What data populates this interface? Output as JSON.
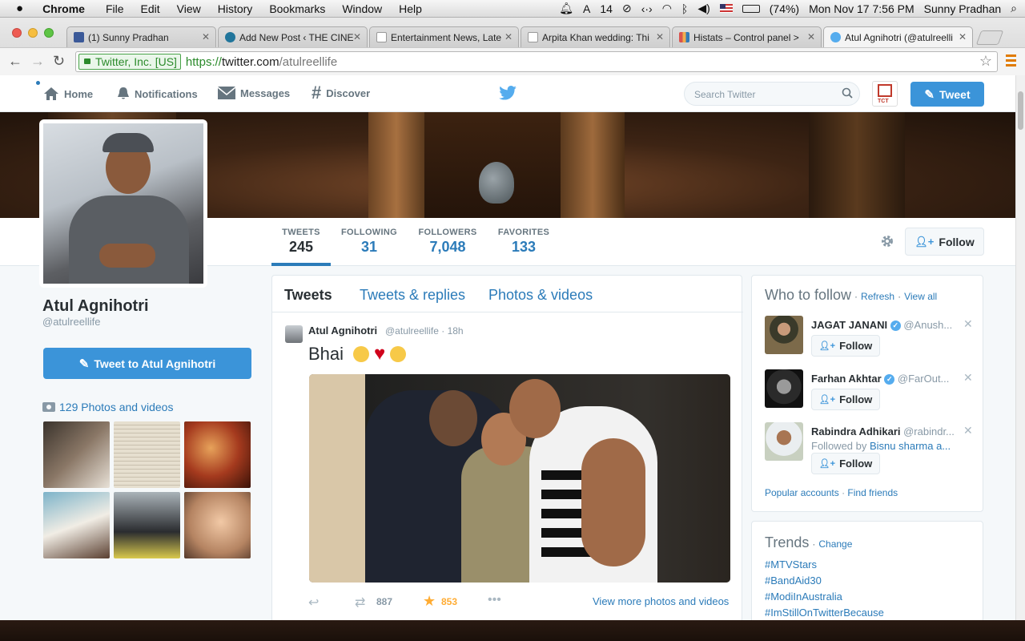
{
  "menubar": {
    "apple": "",
    "app": "Chrome",
    "items": [
      "File",
      "Edit",
      "View",
      "History",
      "Bookmarks",
      "Window",
      "Help"
    ],
    "status_count": "14",
    "battery": "(74%)",
    "datetime": "Mon Nov 17  7:56 PM",
    "user": "Sunny Pradhan"
  },
  "browser": {
    "tabs": [
      {
        "title": "(1) Sunny Pradhan",
        "favicon_color": "#3b5998"
      },
      {
        "title": "Add New Post ‹ THE CINE",
        "favicon_color": "#21759b"
      },
      {
        "title": "Entertainment News, Late",
        "favicon_color": "#999999"
      },
      {
        "title": "Arpita Khan wedding: Thi",
        "favicon_color": "#999999"
      },
      {
        "title": "Histats – Control panel >",
        "favicon_color": "#d9534f"
      },
      {
        "title": "Atul Agnihotri (@atulreelli",
        "favicon_color": "#55acee"
      }
    ],
    "ev_label": "Twitter, Inc. [US]",
    "url_scheme": "https://",
    "url_host": "twitter.com",
    "url_path": "/atulreellife"
  },
  "twitter": {
    "nav": {
      "home": "Home",
      "notifications": "Notifications",
      "messages": "Messages",
      "discover": "Discover",
      "search_placeholder": "Search Twitter",
      "avatar_text": "TCT",
      "tweet_button": "Tweet"
    },
    "profile": {
      "name": "Atul Agnihotri",
      "handle": "@atulreellife",
      "tweet_to": "Tweet to Atul Agnihotri",
      "photos_label": "129 Photos and videos"
    },
    "stats": [
      {
        "label": "TWEETS",
        "value": "245"
      },
      {
        "label": "FOLLOWING",
        "value": "31"
      },
      {
        "label": "FOLLOWERS",
        "value": "7,048"
      },
      {
        "label": "FAVORITES",
        "value": "133"
      }
    ],
    "follow_button": "Follow",
    "feed": {
      "tabs": [
        "Tweets",
        "Tweets & replies",
        "Photos & videos"
      ],
      "tweet": {
        "name": "Atul Agnihotri",
        "handle": "@atulreellife",
        "time": "18h",
        "text": "Bhai",
        "retweets": "887",
        "favorites": "853",
        "view_more": "View more photos and videos"
      }
    },
    "who_to_follow": {
      "title": "Who to follow",
      "refresh": "Refresh",
      "view_all": "View all",
      "suggestions": [
        {
          "name": "JAGAT JANANI",
          "handle": "@Anush...",
          "verified": true,
          "follow": "Follow"
        },
        {
          "name": "Farhan Akhtar",
          "handle": "@FarOut...",
          "verified": true,
          "follow": "Follow"
        },
        {
          "name": "Rabindra Adhikari",
          "handle": "@rabindr...",
          "verified": false,
          "followed_by_prefix": "Followed by",
          "followed_by": "Bisnu sharma a...",
          "follow": "Follow"
        }
      ],
      "popular": "Popular accounts",
      "find_friends": "Find friends"
    },
    "trends": {
      "title": "Trends",
      "change": "Change",
      "items": [
        "#MTVStars",
        "#BandAid30",
        "#ModiInAustralia",
        "#ImStillOnTwitterBecause"
      ]
    }
  }
}
